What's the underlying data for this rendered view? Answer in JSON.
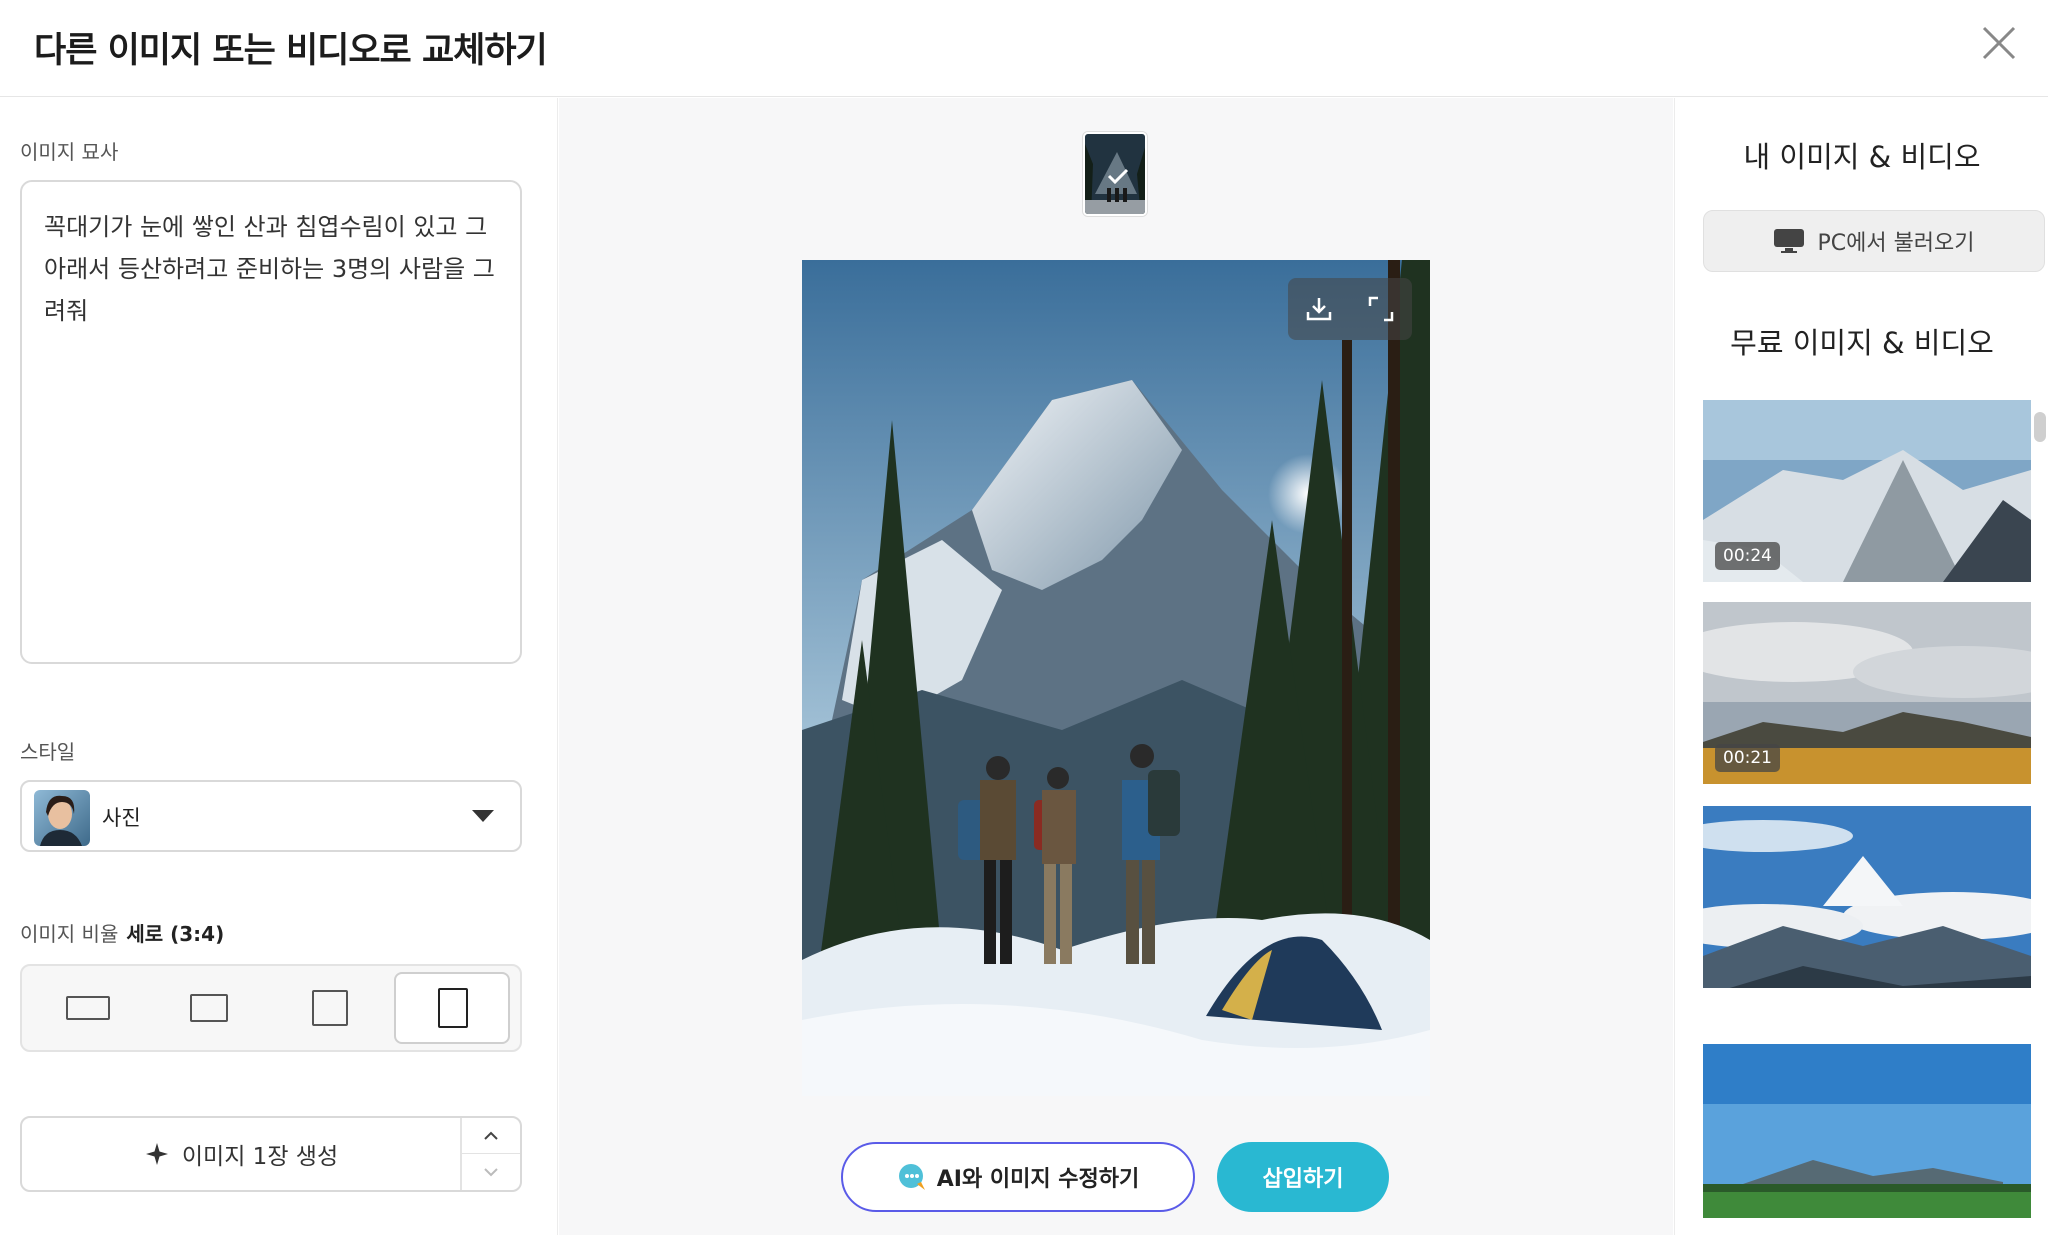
{
  "header": {
    "title": "다른 이미지 또는 비디오로 교체하기"
  },
  "left": {
    "description_label": "이미지 묘사",
    "description_text": "꼭대기가 눈에 쌓인 산과 침엽수림이 있고 그 아래서 등산하려고 준비하는 3명의 사람을 그려줘",
    "style_label": "스타일",
    "style_value": "사진",
    "ratio_label": "이미지 비율",
    "ratio_value": "세로 (3:4)",
    "generate_label": "이미지 1장 생성"
  },
  "center": {
    "ai_edit_label": "AI와 이미지 수정하기",
    "insert_label": "삽입하기"
  },
  "right": {
    "my_media_title": "내 이미지 & 비디오",
    "pc_upload_label": "PC에서 불러오기",
    "free_media_title": "무료 이미지 & 비디오",
    "items": [
      {
        "duration": "00:24"
      },
      {
        "duration": "00:21"
      },
      {
        "duration": ""
      },
      {
        "duration": ""
      }
    ]
  },
  "colors": {
    "accent": "#29b8d2",
    "ai_border": "#5a5be8"
  },
  "icons": [
    "close-icon",
    "caret-down-icon",
    "sparkle-icon",
    "chevron-up-icon",
    "chevron-down-icon",
    "check-icon",
    "download-icon",
    "fullscreen-icon",
    "ai-chat-icon",
    "monitor-icon"
  ]
}
